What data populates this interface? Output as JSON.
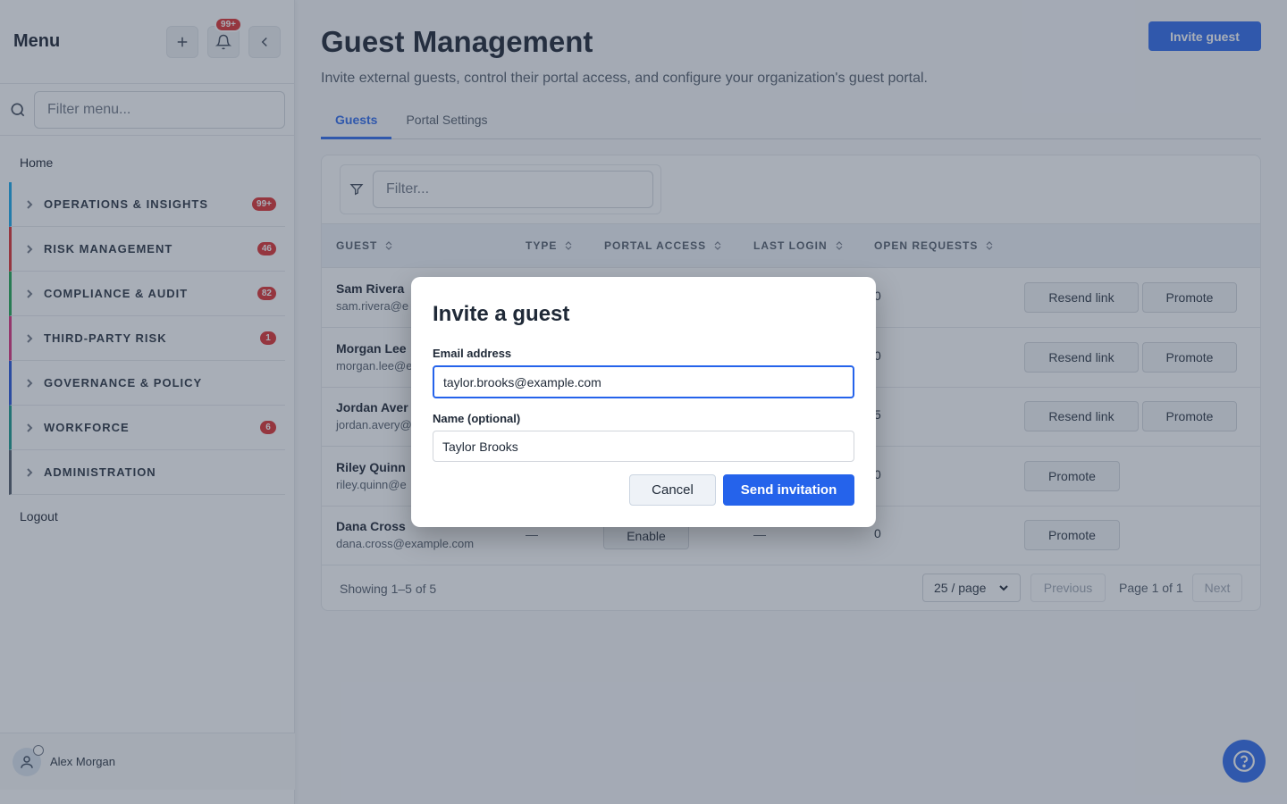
{
  "sidebar": {
    "title": "Menu",
    "notifications_badge": "99+",
    "filter_placeholder": "Filter menu...",
    "home": "Home",
    "groups": [
      {
        "label": "OPERATIONS & INSIGHTS",
        "count": "99+",
        "color": "#0ea5e9"
      },
      {
        "label": "RISK MANAGEMENT",
        "count": "46",
        "color": "#dc2626"
      },
      {
        "label": "COMPLIANCE & AUDIT",
        "count": "82",
        "color": "#16a34a"
      },
      {
        "label": "THIRD-PARTY RISK",
        "count": "1",
        "color": "#db2777"
      },
      {
        "label": "GOVERNANCE & POLICY",
        "count": "",
        "color": "#1d4ed8"
      },
      {
        "label": "WORKFORCE",
        "count": "6",
        "color": "#0d9488"
      },
      {
        "label": "ADMINISTRATION",
        "count": "",
        "color": "#4b5563"
      }
    ],
    "logout": "Logout",
    "user_name": "Alex Morgan"
  },
  "header": {
    "title": "Guest Management",
    "subtitle": "Invite external guests, control their portal access, and configure your organization's guest portal.",
    "invite_button": "Invite guest"
  },
  "tabs": [
    {
      "label": "Guests",
      "active": true
    },
    {
      "label": "Portal Settings",
      "active": false
    }
  ],
  "table": {
    "filter_placeholder": "Filter...",
    "columns": [
      "GUEST",
      "TYPE",
      "PORTAL ACCESS",
      "LAST LOGIN",
      "OPEN REQUESTS"
    ],
    "rows": [
      {
        "name": "Sam Rivera",
        "email": "sam.rivera@e",
        "requests": "0",
        "actions": [
          "Resend link",
          "Promote"
        ]
      },
      {
        "name": "Morgan Lee",
        "email": "morgan.lee@e",
        "requests": "0",
        "actions": [
          "Resend link",
          "Promote"
        ]
      },
      {
        "name": "Jordan Aver",
        "email": "jordan.avery@",
        "requests": "5",
        "actions": [
          "Resend link",
          "Promote"
        ]
      },
      {
        "name": "Riley Quinn",
        "email": "riley.quinn@e",
        "requests": "0",
        "actions": [
          "Promote"
        ]
      },
      {
        "name": "Dana Cross",
        "email": "dana.cross@example.com",
        "type": "—",
        "access": "Enable",
        "login": "—",
        "requests": "0",
        "actions": [
          "Promote"
        ]
      }
    ]
  },
  "pager": {
    "showing": "Showing 1–5 of 5",
    "per_page": "25 / page",
    "previous": "Previous",
    "page_info": "Page 1 of 1",
    "next": "Next"
  },
  "modal": {
    "title": "Invite a guest",
    "email_label": "Email address",
    "email_value": "taylor.brooks@example.com",
    "name_label": "Name (optional)",
    "name_value": "Taylor Brooks",
    "cancel": "Cancel",
    "send": "Send invitation"
  },
  "colors": {
    "accent": "#2563eb",
    "badge": "#dc2626"
  }
}
